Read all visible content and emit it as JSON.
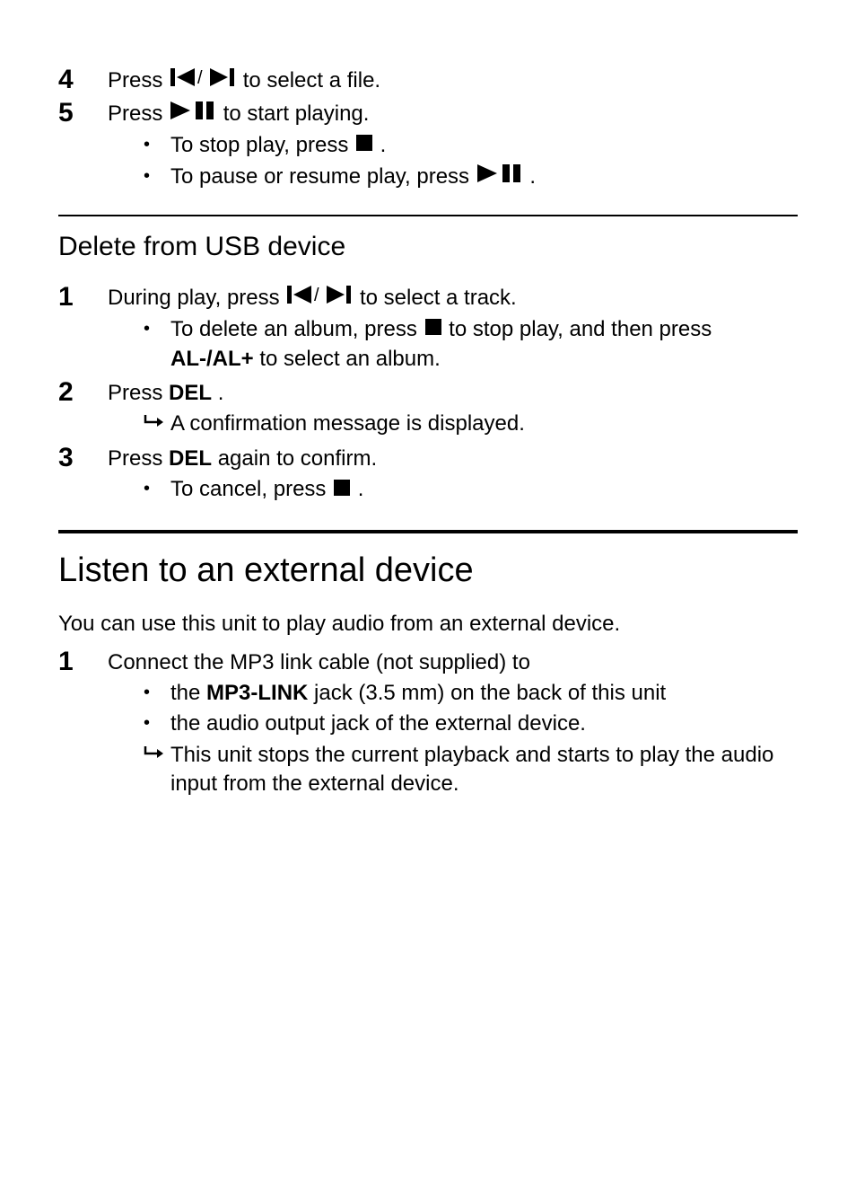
{
  "section_top": {
    "steps": [
      {
        "num": "4",
        "pre": "Press ",
        "post": " to select a file."
      },
      {
        "num": "5",
        "pre": "Press ",
        "post": " to start playing.",
        "subs": [
          {
            "type": "bullet",
            "pre": "To stop play, press ",
            "post": " ."
          },
          {
            "type": "bullet",
            "pre": "To pause or resume play, press ",
            "post": "."
          }
        ]
      }
    ]
  },
  "section_delete": {
    "heading": "Delete from USB device",
    "steps": [
      {
        "num": "1",
        "pre": "During play, press ",
        "post": " to select a track.",
        "subs": [
          {
            "type": "bullet",
            "pre": "To delete an album, press ",
            "mid": " to stop play, and then press ",
            "bold": "AL-/AL+",
            "post2": " to select an album."
          }
        ]
      },
      {
        "num": "2",
        "pre": "Press ",
        "bold": "DEL",
        "post": " .",
        "subs": [
          {
            "type": "arrow",
            "text": "A confirmation message is displayed."
          }
        ]
      },
      {
        "num": "3",
        "pre": "Press ",
        "bold": "DEL",
        "post": " again to confirm.",
        "subs": [
          {
            "type": "bullet",
            "pre": "To cancel, press ",
            "post": " ."
          }
        ]
      }
    ]
  },
  "section_listen": {
    "heading": "Listen to an external device",
    "intro": "You can use this unit to play audio from an external device.",
    "steps": [
      {
        "num": "1",
        "text": "Connect the MP3 link cable (not supplied) to",
        "subs": [
          {
            "type": "bullet",
            "pre": "the ",
            "bold": "MP3-LINK",
            "post": " jack (3.5 mm) on the back of this unit"
          },
          {
            "type": "bullet",
            "text": "the audio output jack of the external device."
          },
          {
            "type": "arrow",
            "text": "This unit stops the current playback and starts to play the audio input from the external device."
          }
        ]
      }
    ]
  }
}
